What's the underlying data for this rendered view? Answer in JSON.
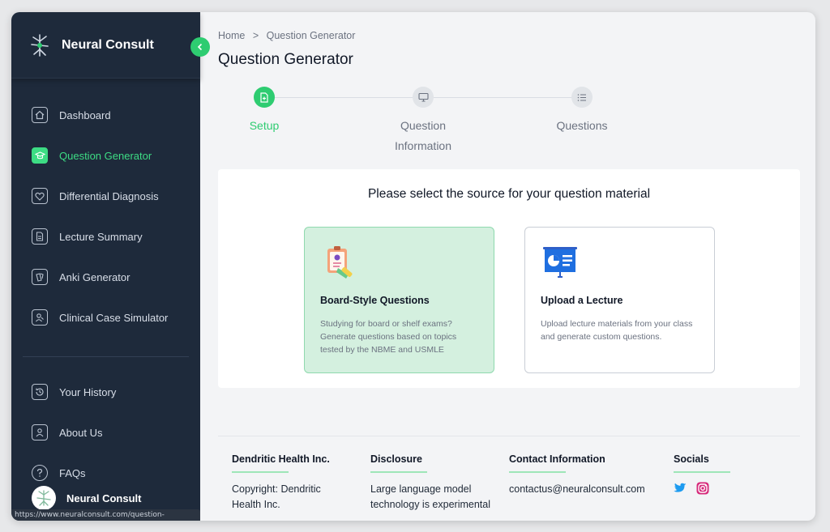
{
  "sidebar": {
    "brand": "Neural Consult",
    "nav_items": [
      {
        "label": "Dashboard",
        "icon": "home-icon",
        "active": false
      },
      {
        "label": "Question Generator",
        "icon": "graduation-cap-icon",
        "active": true
      },
      {
        "label": "Differential Diagnosis",
        "icon": "heart-icon",
        "active": false
      },
      {
        "label": "Lecture Summary",
        "icon": "document-icon",
        "active": false
      },
      {
        "label": "Anki Generator",
        "icon": "cards-icon",
        "active": false
      },
      {
        "label": "Clinical Case Simulator",
        "icon": "user-case-icon",
        "active": false
      }
    ],
    "bottom_items": [
      {
        "label": "Your History",
        "icon": "history-icon"
      },
      {
        "label": "About Us",
        "icon": "people-icon"
      },
      {
        "label": "FAQs",
        "icon": "question-icon"
      }
    ],
    "user_name": "Neural Consult",
    "status_url": "https://www.neuralconsult.com/question-generator"
  },
  "breadcrumb": {
    "home": "Home",
    "separator": ">",
    "current": "Question Generator"
  },
  "page_title": "Question Generator",
  "stepper": {
    "steps": [
      {
        "label": "Setup",
        "icon": "document-plus-icon",
        "active": true
      },
      {
        "label": "Question Information",
        "line1": "Question",
        "line2": "Information",
        "icon": "monitor-icon",
        "active": false
      },
      {
        "label": "Questions",
        "icon": "list-icon",
        "active": false
      }
    ]
  },
  "panel": {
    "title": "Please select the source for your question material",
    "cards": [
      {
        "title": "Board-Style Questions",
        "description": "Studying for board or shelf exams? Generate questions based on topics tested by the NBME and USMLE",
        "icon": "clipboard-illustration-icon",
        "selected": true
      },
      {
        "title": "Upload a Lecture",
        "description": "Upload lecture materials from your class and generate custom questions.",
        "icon": "presentation-board-icon",
        "selected": false
      }
    ]
  },
  "footer": {
    "company": {
      "heading": "Dendritic Health Inc.",
      "text": "Copyright: Dendritic Health Inc."
    },
    "disclosure": {
      "heading": "Disclosure",
      "text": "Large language model technology is experimental"
    },
    "contact": {
      "heading": "Contact Information",
      "email": "contactus@neuralconsult.com"
    },
    "socials": {
      "heading": "Socials",
      "icons": [
        "twitter-icon",
        "instagram-icon"
      ]
    }
  },
  "colors": {
    "accent": "#2ecc71",
    "sidebar_bg": "#1e2a3b",
    "card_selected_bg": "#d4f0df"
  }
}
